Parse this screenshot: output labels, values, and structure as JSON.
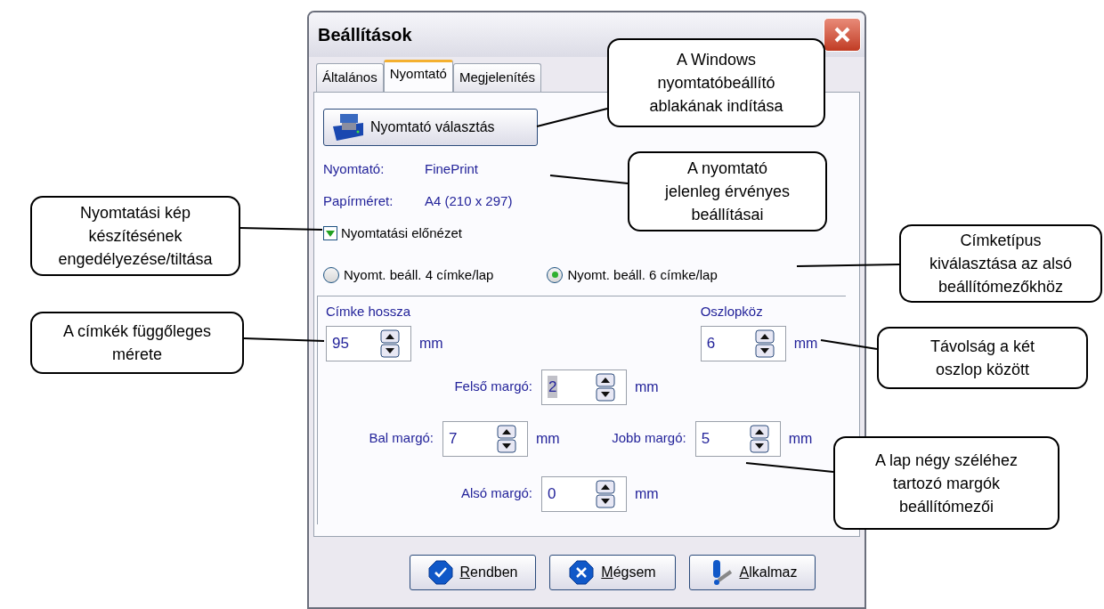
{
  "window": {
    "title": "Beállítások"
  },
  "tabs": [
    {
      "label": "Általános",
      "selected": false
    },
    {
      "label": "Nyomtató",
      "selected": true
    },
    {
      "label": "Megjelenítés",
      "selected": false
    }
  ],
  "printer_button": {
    "label": "Nyomtató választás"
  },
  "info": [
    {
      "label": "Nyomtató:",
      "value": "FinePrint"
    },
    {
      "label": "Papírméret:",
      "value": "A4 (210 x 297)"
    }
  ],
  "preview_checkbox": {
    "label": "Nyomtatási előnézet",
    "checked": true
  },
  "label_type": [
    {
      "label": "Nyomt. beáll. 4 címke/lap",
      "selected": false
    },
    {
      "label": "Nyomt. beáll. 6 címke/lap",
      "selected": true
    }
  ],
  "label_length": {
    "label": "Címke hossza",
    "value": "95",
    "unit": "mm",
    "text_selected": false
  },
  "column_gap": {
    "label": "Oszlopköz",
    "value": "6",
    "unit": "mm",
    "text_selected": false
  },
  "top_margin": {
    "label": "Felső margó:",
    "value": "2",
    "unit": "mm",
    "text_selected": true
  },
  "left_margin": {
    "label": "Bal margó:",
    "value": "7",
    "unit": "mm",
    "text_selected": false
  },
  "right_margin": {
    "label": "Jobb margó:",
    "value": "5",
    "unit": "mm",
    "text_selected": false
  },
  "bottom_margin": {
    "label": "Alsó margó:",
    "value": "0",
    "unit": "mm",
    "text_selected": false
  },
  "buttons": [
    {
      "label": "Rendben",
      "kind": "ok"
    },
    {
      "label": "Mégsem",
      "kind": "cancel"
    },
    {
      "label": "Alkalmaz",
      "kind": "apply"
    }
  ],
  "callouts": [
    {
      "text": "A Windows\nnyomtatóbeállító\nablakának indítása"
    },
    {
      "text": "A nyomtató\njelenleg érvényes\nbeállításai"
    },
    {
      "text": "Nyomtatási kép\nkészítésének\nengedélyezése/tiltása"
    },
    {
      "text": "Címketípus\nkiválasztása az alsó\nbeállítómezőkhöz"
    },
    {
      "text": "A címkék függőleges\nmérete"
    },
    {
      "text": "Távolság a két\noszlop között"
    },
    {
      "text": "A lap négy széléhez\ntartozó margók\nbeállítómezői"
    }
  ]
}
